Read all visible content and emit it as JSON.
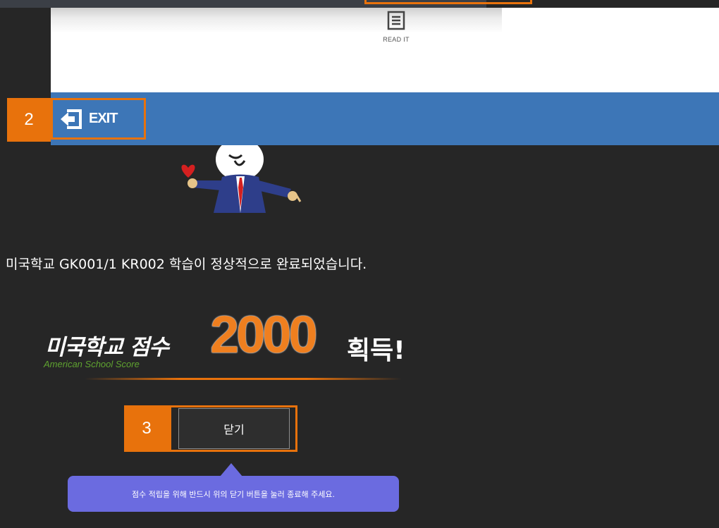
{
  "reader": {
    "read_it_label": "READ IT",
    "read_it_icon": "document-lines-icon"
  },
  "markers": {
    "exit_marker": "2",
    "close_marker": "3"
  },
  "toolbar": {
    "exit_label": "EXIT",
    "exit_icon": "exit-arrow-icon"
  },
  "result": {
    "completion_message": "미국학교  GK001/1  KR002 학습이 정상적으로 완료되었습니다.",
    "score_label_ko": "미국학교 점수",
    "score_label_en": "American School Score",
    "score_value": "2000",
    "score_suffix": "획득!"
  },
  "actions": {
    "close_label": "닫기"
  },
  "tooltip": {
    "text": "점수 적립을 위해 반드시 위의 닫기 버튼을 눌러 종료해 주세요."
  },
  "colors": {
    "accent_orange": "#e8720c",
    "bar_blue": "#3d76b7",
    "tooltip_purple": "#6b6be0",
    "background": "#262626"
  }
}
